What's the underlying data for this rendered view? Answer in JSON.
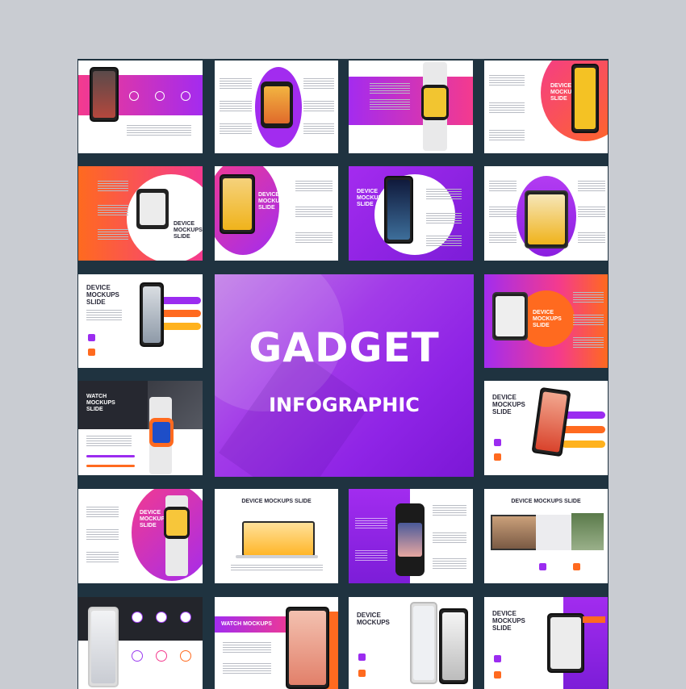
{
  "hero": {
    "title": "GADGET",
    "subtitle": "INFOGRAPHIC"
  },
  "slides": {
    "r2c2": "DEVICE\nMOCKUPS\nSLIDE",
    "r2c3": "DEVICE\nMOCKUPS\nSLIDE",
    "r2c1": "DEVICE\nMOCKUPS\nSLIDE",
    "r1c4": "DEVICE\nMOCKUPS\nSLIDE",
    "r3c1": "DEVICE\nMOCKUPS\nSLIDE",
    "r3c4": "DEVICE\nMOCKUPS\nSLIDE",
    "r4c1": "WATCH\nMOCKUPS\nSLIDE",
    "r4c4": "DEVICE\nMOCKUPS\nSLIDE",
    "r5c1": "DEVICE\nMOCKUPS\nSLIDE",
    "r5c2": "DEVICE MOCKUPS SLIDE",
    "r5c4": "DEVICE MOCKUPS SLIDE",
    "r6c2": "WATCH MOCKUPS",
    "r6c3": "DEVICE\nMOCKUPS",
    "r6c4": "DEVICE\nMOCKUPS\nSLIDE"
  },
  "colors": {
    "purple": "#9b2cf0",
    "pink": "#f0389a",
    "orange": "#ff6a1f",
    "board": "#1f3340"
  },
  "icons": [
    "smartphone-icon",
    "smartwatch-icon",
    "tablet-icon",
    "laptop-icon"
  ]
}
